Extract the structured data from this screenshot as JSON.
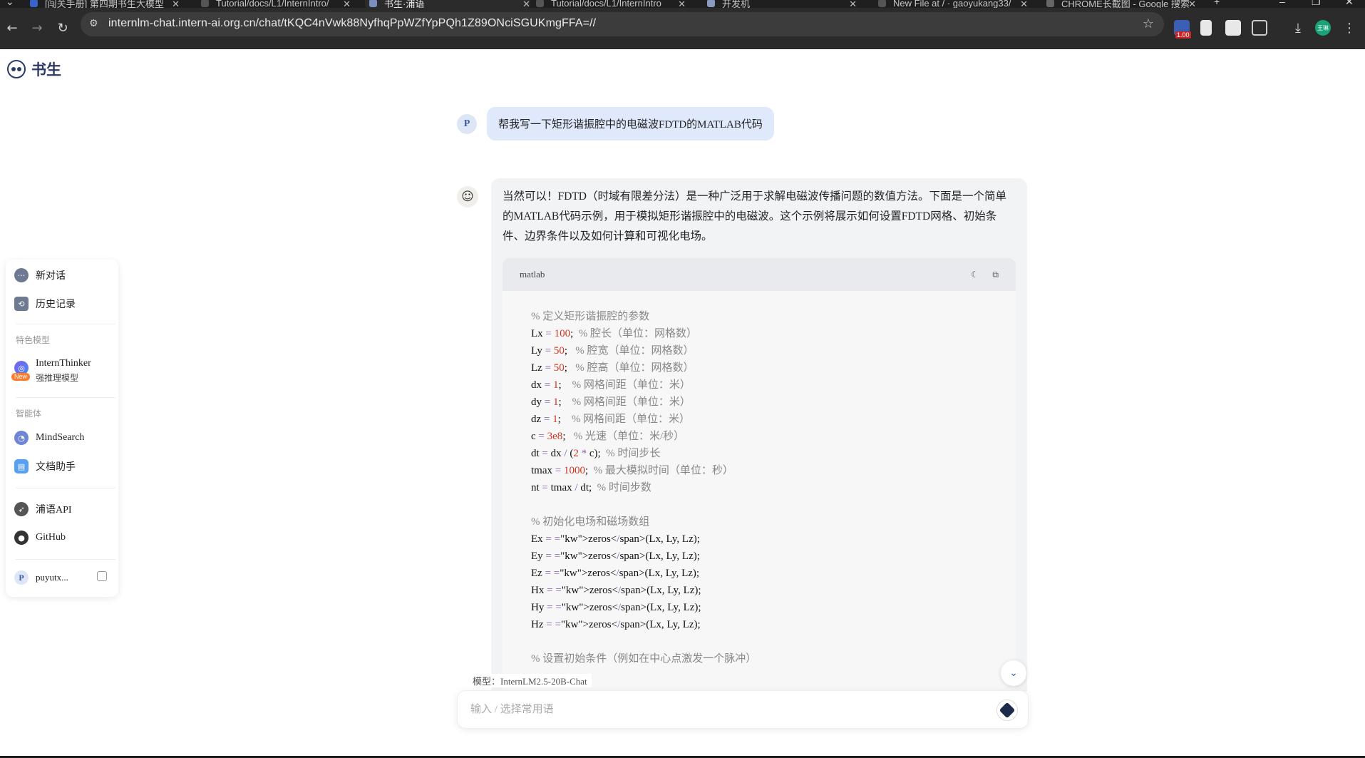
{
  "browser": {
    "tabs": [
      {
        "title": "[闯关手册] 第四期书生大模型"
      },
      {
        "title": "Tutorial/docs/L1/InternIntro/"
      },
      {
        "title": "书生·浦语"
      },
      {
        "title": "Tutorial/docs/L1/InternIntro"
      },
      {
        "title": "开发机"
      },
      {
        "title": "New File at / · gaoyukang33/"
      },
      {
        "title": "CHROME长截图 - Google 搜索"
      }
    ],
    "url": "internlm-chat.intern-ai.org.cn/chat/tKQC4nVwk88NyfhqPpWZfYpPQh1Z89ONciSGUKmgFFA=//",
    "extension_badge": "1.00",
    "profile_initials": "王琳"
  },
  "app": {
    "logo_text": "书生"
  },
  "sidebar": {
    "new_chat": "新对话",
    "history": "历史记录",
    "featured_heading": "特色模型",
    "featured_model_name": "InternThinker",
    "featured_model_desc": "强推理模型",
    "new_badge": "New",
    "agents_heading": "智能体",
    "agent_mindsearch": "MindSearch",
    "agent_doc": "文档助手",
    "api": "浦语API",
    "github": "GitHub",
    "user_initial": "P",
    "user_name": "puyutx..."
  },
  "chat": {
    "user_initial": "P",
    "user_message": "帮我写一下矩形谐振腔中的电磁波FDTD的MATLAB代码",
    "assistant_intro": "当然可以！FDTD（时域有限差分法）是一种广泛用于求解电磁波传播问题的数值方法。下面是一个简单的MATLAB代码示例，用于模拟矩形谐振腔中的电磁波。这个示例将展示如何设置FDTD网格、初始条件、边界条件以及如何计算和可视化电场。",
    "code_lang": "matlab",
    "code_lines": [
      "% 定义矩形谐振腔的参数",
      "Lx = 100;  % 腔长（单位：网格数）",
      "Ly = 50;   % 腔宽（单位：网格数）",
      "Lz = 50;   % 腔高（单位：网格数）",
      "dx = 1;    % 网格间距（单位：米）",
      "dy = 1;    % 网格间距（单位：米）",
      "dz = 1;    % 网格间距（单位：米）",
      "c = 3e8;   % 光速（单位：米/秒）",
      "dt = dx / (2 * c);  % 时间步长",
      "tmax = 1000;  % 最大模拟时间（单位：秒）",
      "nt = tmax / dt;  % 时间步数",
      "",
      "% 初始化电场和磁场数组",
      "Ex = zeros(Lx, Ly, Lz);",
      "Ey = zeros(Lx, Ly, Lz);",
      "Ez = zeros(Lx, Ly, Lz);",
      "Hx = zeros(Lx, Ly, Lz);",
      "Hy = zeros(Lx, Ly, Lz);",
      "Hz = zeros(Lx, Ly, Lz);",
      "",
      "% 设置初始条件（例如在中心点激发一个脉冲）"
    ]
  },
  "footer": {
    "model_label": "模型：InternLM2.5-20B-Chat",
    "input_placeholder": "输入 / 选择常用语"
  },
  "colors": {
    "brand": "#2c3a66",
    "user_bubble": "#dfe9fb",
    "bot_bubble": "#f2f3f5",
    "comment": "#888888",
    "number": "#d0321e",
    "function": "#2a8a2a"
  }
}
